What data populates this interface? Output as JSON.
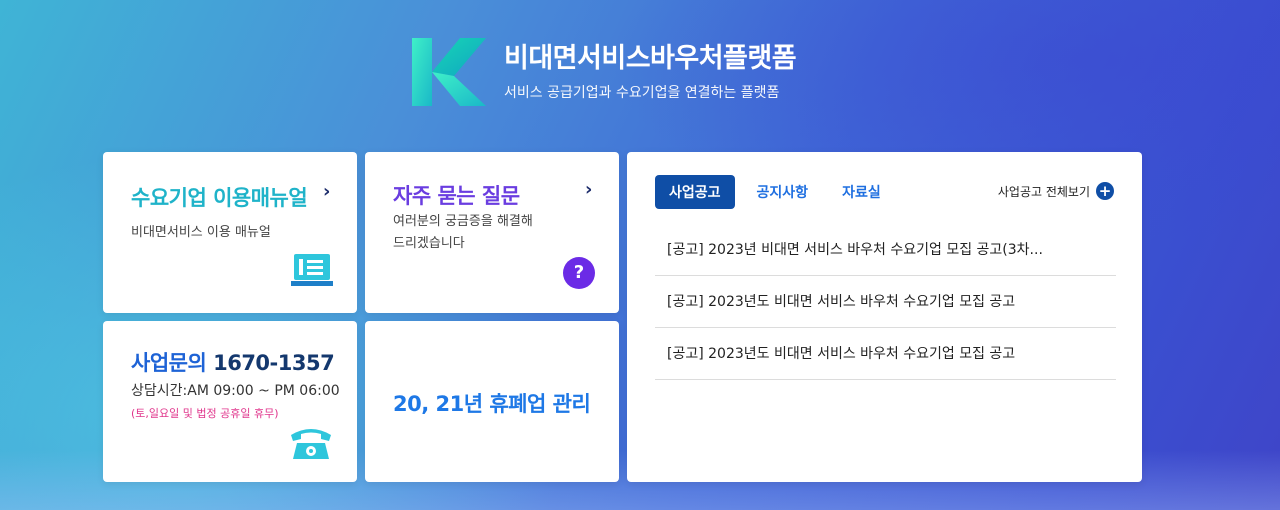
{
  "brand": {
    "title": "비대면서비스바우처플랫폼",
    "subtitle": "서비스 공급기업과 수요기업을 연결하는 플랫폼"
  },
  "cards": {
    "manual": {
      "title": "수요기업 이용매뉴얼",
      "desc": "비대면서비스 이용 매뉴얼",
      "icon": "manual-book-icon"
    },
    "faq": {
      "title": "자주 묻는 질문",
      "desc_line1": "여러분의 궁금증을 해결해",
      "desc_line2": "드리겠습니다",
      "icon": "question-mark-icon",
      "icon_text": "?"
    },
    "contact": {
      "title_prefix": "사업문의 ",
      "phone": "1670-1357",
      "hours": "상담시간:AM 09:00 ~ PM 06:00",
      "note": "(토,일요일 및 법정 공휴일 휴무)",
      "icon": "telephone-icon"
    },
    "closure": {
      "title": "20, 21년 휴폐업 관리"
    }
  },
  "notices": {
    "tabs": [
      {
        "label": "사업공고",
        "active": true
      },
      {
        "label": "공지사항",
        "active": false
      },
      {
        "label": "자료실",
        "active": false
      }
    ],
    "view_all_label": "사업공고 전체보기",
    "view_all_icon": "+",
    "items": [
      "[공고] 2023년 비대면 서비스 바우처 수요기업 모집 공고(3차...",
      "[공고] 2023년도 비대면 서비스 바우처 수요기업 모집 공고",
      "[공고] 2023년도 비대면 서비스 바우처 수요기업 모집 공고"
    ]
  },
  "colors": {
    "manual_title": "#1fb3c9",
    "faq_title": "#6a3de0",
    "contact_title": "#1e63d6",
    "closure_title": "#1e78e6",
    "active_tab_bg": "#0f4ea6",
    "tab_text": "#1f6fe0",
    "note_pink": "#e0368c"
  }
}
